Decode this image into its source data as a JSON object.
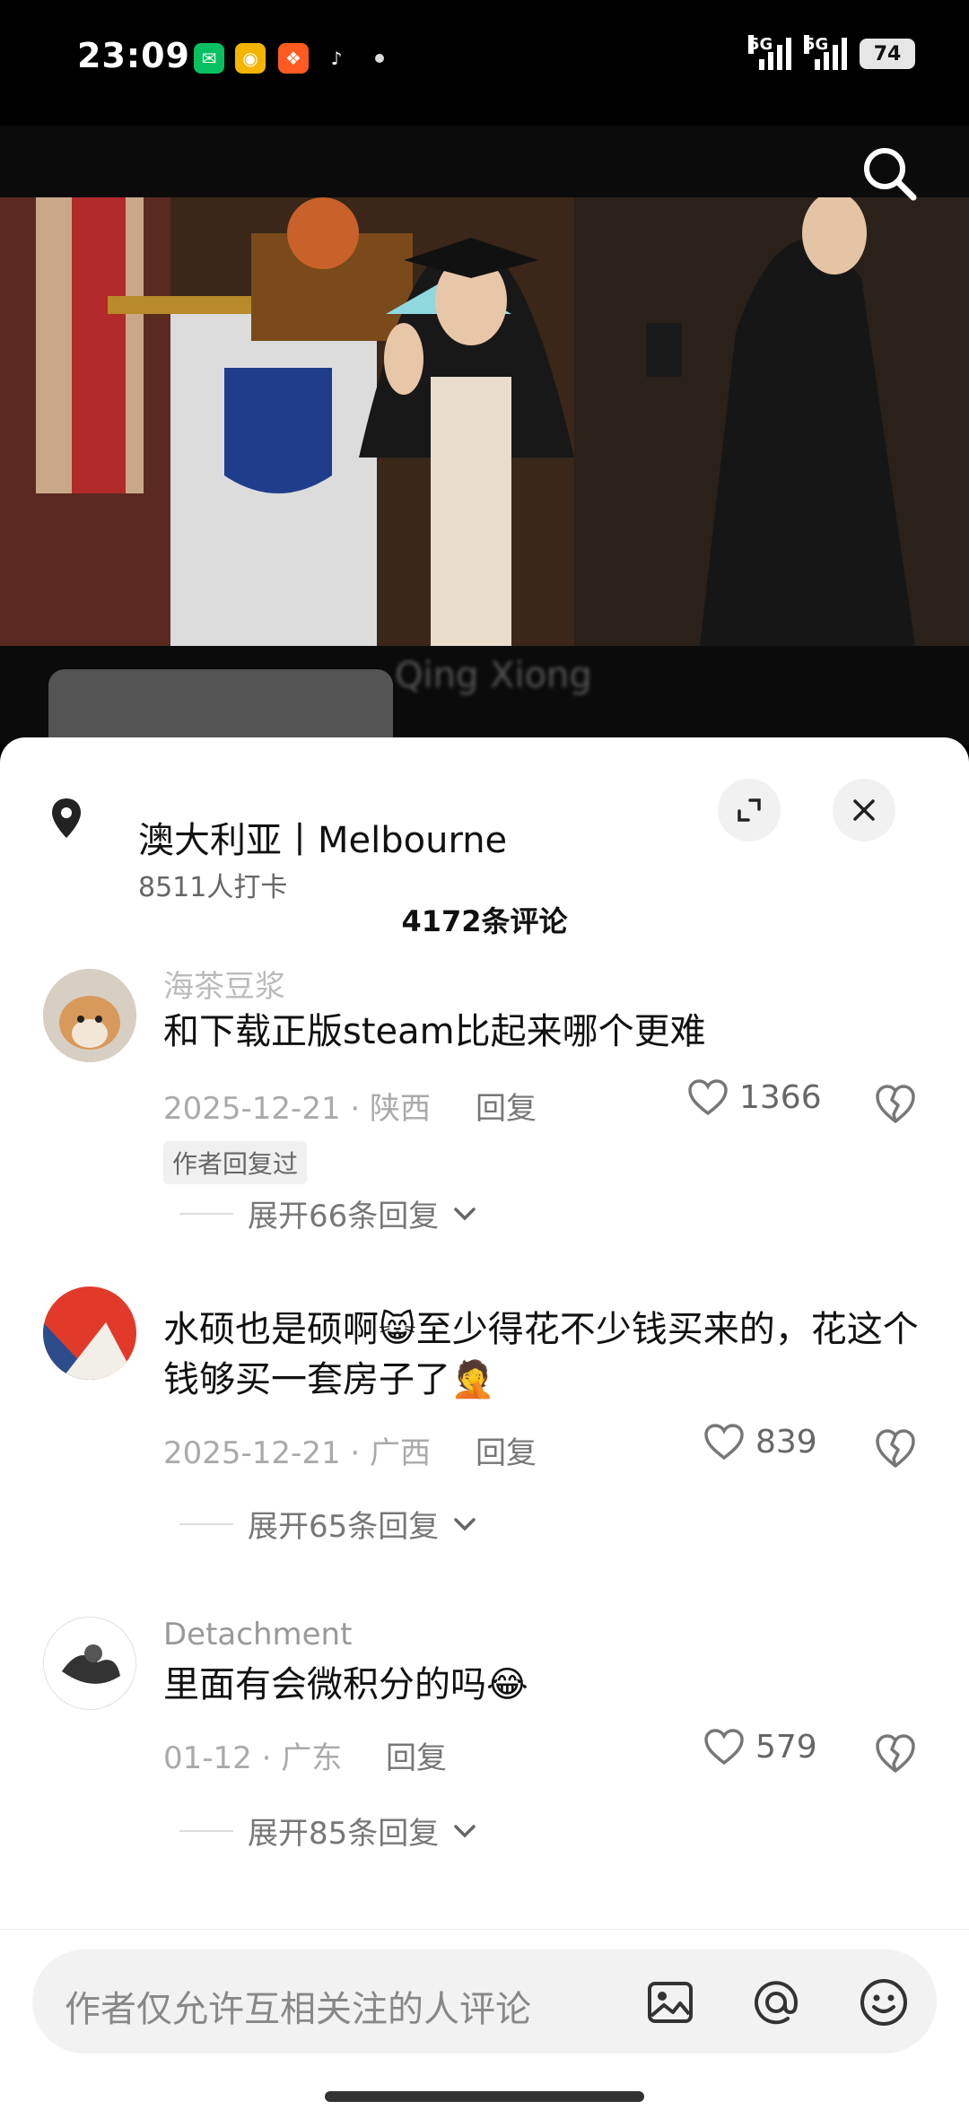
{
  "status_bar": {
    "time": "23:09",
    "net1": "5G",
    "net2": "5G",
    "battery": "74"
  },
  "video": {
    "caption": "Qing Xiong"
  },
  "location": {
    "title": "澳大利亚丨Melbourne",
    "subtitle": "8511人打卡"
  },
  "comments_header": {
    "count_label": "4172条评论"
  },
  "comments": [
    {
      "user": "海茶豆浆",
      "text": "和下载正版steam比起来哪个更难",
      "meta": "2025-12-21 · 陕西",
      "reply": "回复",
      "likes": "1366",
      "author_badge": "作者回复过",
      "expand": "展开66条回复"
    },
    {
      "text": "水硕也是硕啊😸至少得花不少钱买来的，花这个钱够买一套房子了🤦",
      "meta": "2025-12-21 · 广西",
      "reply": "回复",
      "likes": "839",
      "expand": "展开65条回复"
    },
    {
      "user": "Detachment",
      "text": "里面有会微积分的吗😂",
      "meta": "01-12 · 广东",
      "reply": "回复",
      "likes": "579",
      "expand": "展开85条回复"
    }
  ],
  "input": {
    "placeholder": "作者仅允许互相关注的人评论"
  }
}
